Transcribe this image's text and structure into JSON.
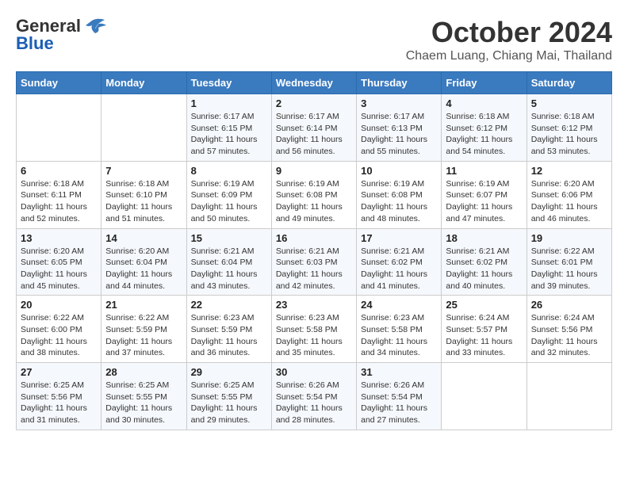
{
  "logo": {
    "general": "General",
    "blue": "Blue"
  },
  "title": "October 2024",
  "location": "Chaem Luang, Chiang Mai, Thailand",
  "weekdays": [
    "Sunday",
    "Monday",
    "Tuesday",
    "Wednesday",
    "Thursday",
    "Friday",
    "Saturday"
  ],
  "weeks": [
    [
      null,
      null,
      {
        "day": 1,
        "sunrise": "6:17 AM",
        "sunset": "6:15 PM",
        "daylight": "11 hours and 57 minutes."
      },
      {
        "day": 2,
        "sunrise": "6:17 AM",
        "sunset": "6:14 PM",
        "daylight": "11 hours and 56 minutes."
      },
      {
        "day": 3,
        "sunrise": "6:17 AM",
        "sunset": "6:13 PM",
        "daylight": "11 hours and 55 minutes."
      },
      {
        "day": 4,
        "sunrise": "6:18 AM",
        "sunset": "6:12 PM",
        "daylight": "11 hours and 54 minutes."
      },
      {
        "day": 5,
        "sunrise": "6:18 AM",
        "sunset": "6:12 PM",
        "daylight": "11 hours and 53 minutes."
      }
    ],
    [
      {
        "day": 6,
        "sunrise": "6:18 AM",
        "sunset": "6:11 PM",
        "daylight": "11 hours and 52 minutes."
      },
      {
        "day": 7,
        "sunrise": "6:18 AM",
        "sunset": "6:10 PM",
        "daylight": "11 hours and 51 minutes."
      },
      {
        "day": 8,
        "sunrise": "6:19 AM",
        "sunset": "6:09 PM",
        "daylight": "11 hours and 50 minutes."
      },
      {
        "day": 9,
        "sunrise": "6:19 AM",
        "sunset": "6:08 PM",
        "daylight": "11 hours and 49 minutes."
      },
      {
        "day": 10,
        "sunrise": "6:19 AM",
        "sunset": "6:08 PM",
        "daylight": "11 hours and 48 minutes."
      },
      {
        "day": 11,
        "sunrise": "6:19 AM",
        "sunset": "6:07 PM",
        "daylight": "11 hours and 47 minutes."
      },
      {
        "day": 12,
        "sunrise": "6:20 AM",
        "sunset": "6:06 PM",
        "daylight": "11 hours and 46 minutes."
      }
    ],
    [
      {
        "day": 13,
        "sunrise": "6:20 AM",
        "sunset": "6:05 PM",
        "daylight": "11 hours and 45 minutes."
      },
      {
        "day": 14,
        "sunrise": "6:20 AM",
        "sunset": "6:04 PM",
        "daylight": "11 hours and 44 minutes."
      },
      {
        "day": 15,
        "sunrise": "6:21 AM",
        "sunset": "6:04 PM",
        "daylight": "11 hours and 43 minutes."
      },
      {
        "day": 16,
        "sunrise": "6:21 AM",
        "sunset": "6:03 PM",
        "daylight": "11 hours and 42 minutes."
      },
      {
        "day": 17,
        "sunrise": "6:21 AM",
        "sunset": "6:02 PM",
        "daylight": "11 hours and 41 minutes."
      },
      {
        "day": 18,
        "sunrise": "6:21 AM",
        "sunset": "6:02 PM",
        "daylight": "11 hours and 40 minutes."
      },
      {
        "day": 19,
        "sunrise": "6:22 AM",
        "sunset": "6:01 PM",
        "daylight": "11 hours and 39 minutes."
      }
    ],
    [
      {
        "day": 20,
        "sunrise": "6:22 AM",
        "sunset": "6:00 PM",
        "daylight": "11 hours and 38 minutes."
      },
      {
        "day": 21,
        "sunrise": "6:22 AM",
        "sunset": "5:59 PM",
        "daylight": "11 hours and 37 minutes."
      },
      {
        "day": 22,
        "sunrise": "6:23 AM",
        "sunset": "5:59 PM",
        "daylight": "11 hours and 36 minutes."
      },
      {
        "day": 23,
        "sunrise": "6:23 AM",
        "sunset": "5:58 PM",
        "daylight": "11 hours and 35 minutes."
      },
      {
        "day": 24,
        "sunrise": "6:23 AM",
        "sunset": "5:58 PM",
        "daylight": "11 hours and 34 minutes."
      },
      {
        "day": 25,
        "sunrise": "6:24 AM",
        "sunset": "5:57 PM",
        "daylight": "11 hours and 33 minutes."
      },
      {
        "day": 26,
        "sunrise": "6:24 AM",
        "sunset": "5:56 PM",
        "daylight": "11 hours and 32 minutes."
      }
    ],
    [
      {
        "day": 27,
        "sunrise": "6:25 AM",
        "sunset": "5:56 PM",
        "daylight": "11 hours and 31 minutes."
      },
      {
        "day": 28,
        "sunrise": "6:25 AM",
        "sunset": "5:55 PM",
        "daylight": "11 hours and 30 minutes."
      },
      {
        "day": 29,
        "sunrise": "6:25 AM",
        "sunset": "5:55 PM",
        "daylight": "11 hours and 29 minutes."
      },
      {
        "day": 30,
        "sunrise": "6:26 AM",
        "sunset": "5:54 PM",
        "daylight": "11 hours and 28 minutes."
      },
      {
        "day": 31,
        "sunrise": "6:26 AM",
        "sunset": "5:54 PM",
        "daylight": "11 hours and 27 minutes."
      },
      null,
      null
    ]
  ],
  "labels": {
    "sunrise": "Sunrise:",
    "sunset": "Sunset:",
    "daylight": "Daylight:"
  }
}
